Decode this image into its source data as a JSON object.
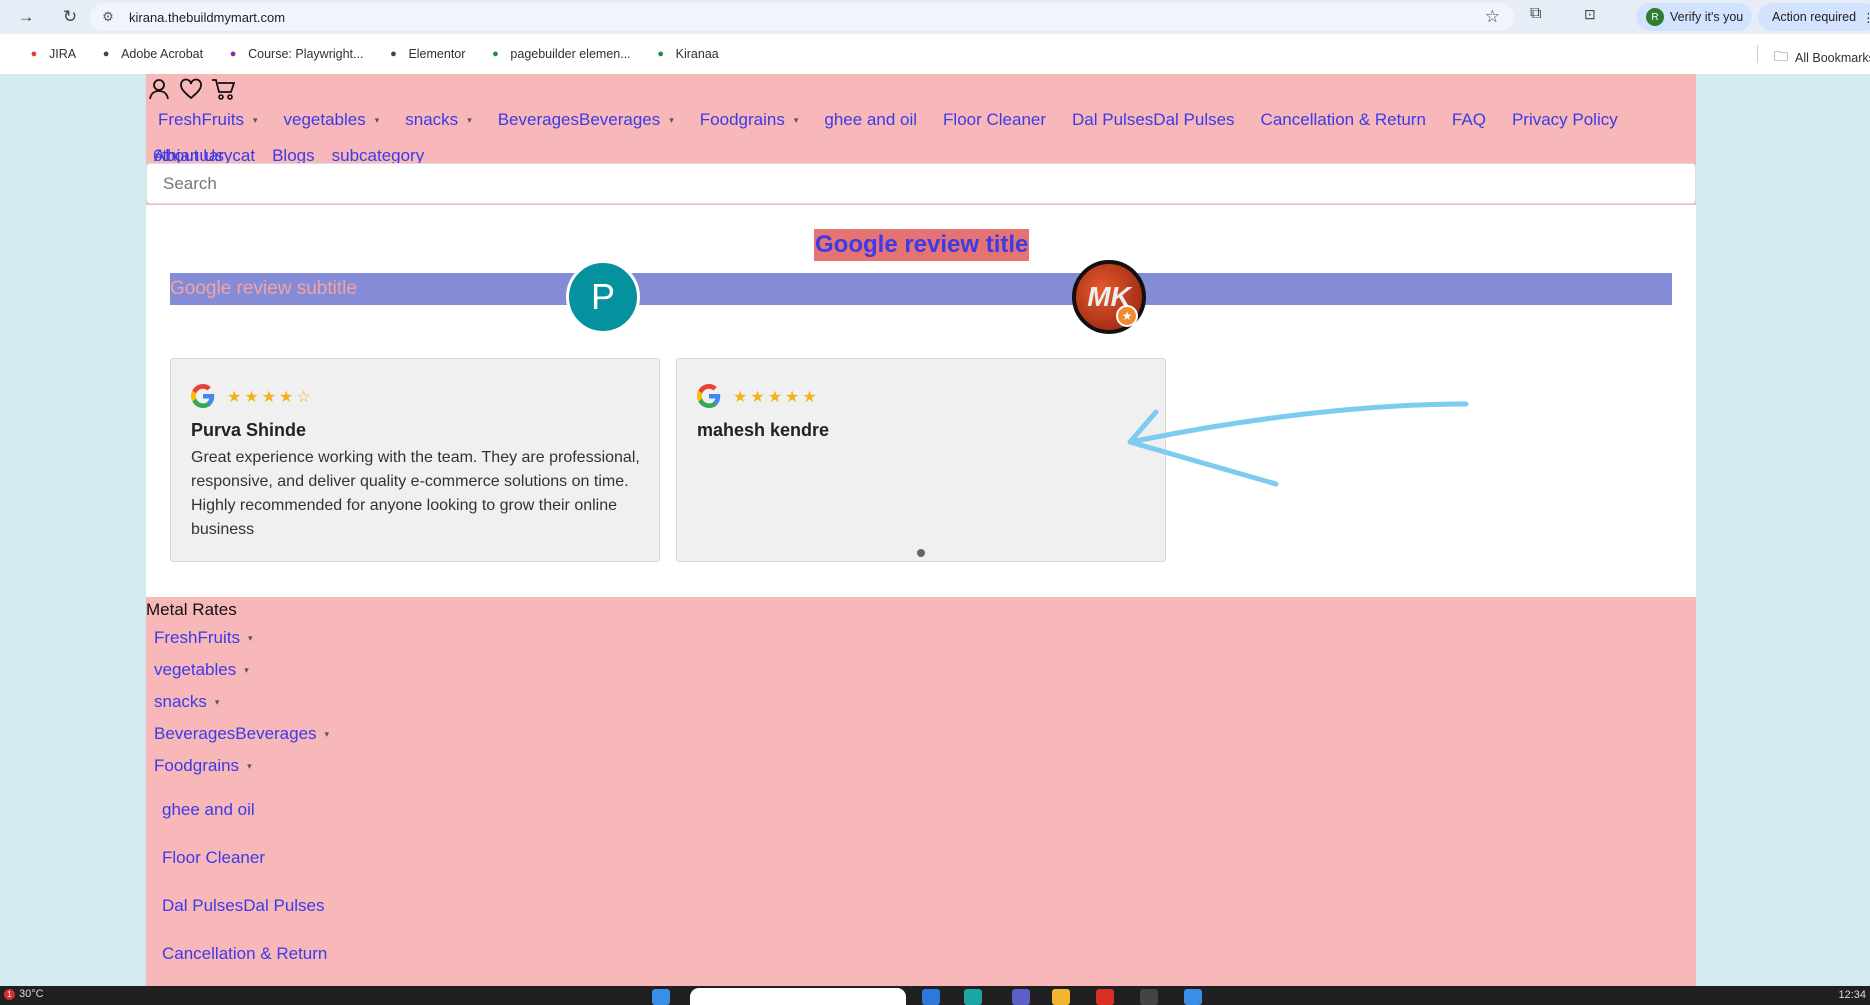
{
  "browser": {
    "url": "kirana.thebuildmymart.com",
    "verify_label": "Verify it's you",
    "verify_avatar": "R",
    "action_label": "Action required",
    "bookmarks": [
      {
        "label": "JIRA",
        "icon": "jira-icon",
        "color": "#e53935"
      },
      {
        "label": "Adobe Acrobat",
        "icon": "acrobat-icon",
        "color": "#444444"
      },
      {
        "label": "Course: Playwright...",
        "icon": "course-icon",
        "color": "#8e24aa"
      },
      {
        "label": "Elementor",
        "icon": "elementor-icon",
        "color": "#444444"
      },
      {
        "label": "pagebuilder elemen...",
        "icon": "sheets-icon",
        "color": "#1e8e3e"
      },
      {
        "label": "Kiranaa",
        "icon": "check-icon",
        "color": "#1e8e3e"
      }
    ],
    "all_bookmarks": "All Bookmarks"
  },
  "header": {
    "menu": [
      {
        "label": "FreshFruits",
        "dropdown": true
      },
      {
        "label": "vegetables",
        "dropdown": true
      },
      {
        "label": "snacks",
        "dropdown": true
      },
      {
        "label": "BeveragesBeverages",
        "dropdown": true
      },
      {
        "label": "Foodgrains",
        "dropdown": true
      },
      {
        "label": "ghee and oil",
        "dropdown": false
      },
      {
        "label": "Floor Cleaner",
        "dropdown": false
      },
      {
        "label": "Dal PulsesDal Pulses",
        "dropdown": false
      },
      {
        "label": "Cancellation & Return",
        "dropdown": false
      },
      {
        "label": "FAQ",
        "dropdown": false
      },
      {
        "label": "Privacy Policy",
        "dropdown": false
      },
      {
        "label": "About Us",
        "dropdown": false
      }
    ],
    "menu_row2": [
      "6thjanuarycat",
      "Blogs",
      "subcategory"
    ],
    "search_placeholder": "Search"
  },
  "reviews": {
    "title": "Google review title",
    "subtitle": "Google review subtitle",
    "items": [
      {
        "name": "Purva Shinde",
        "rating": 4,
        "avatar": "P",
        "text": "Great experience working with the team. They are professional, responsive, and deliver quality e-commerce solutions on time. Highly recommended for anyone looking to grow their online business"
      },
      {
        "name": "mahesh kendre",
        "rating": 5,
        "avatar": "MK",
        "text": ""
      }
    ]
  },
  "footer": {
    "title": "Metal Rates",
    "dropdown_items": [
      "FreshFruits",
      "vegetables",
      "snacks",
      "BeveragesBeverages",
      "Foodgrains"
    ],
    "plain_items": [
      "ghee and oil",
      "Floor Cleaner",
      "Dal PulsesDal Pulses",
      "Cancellation & Return"
    ]
  },
  "taskbar": {
    "weather": "30°C",
    "weather_badge": "1",
    "clock": "12:34"
  },
  "colors": {
    "page_bg": "#f8b7b8",
    "link": "#3b3be8",
    "title_bg": "#e57373",
    "subtitle_bg": "#848cd8",
    "star": "#f6b01e",
    "annotation_arrow": "#7ecbf0"
  }
}
